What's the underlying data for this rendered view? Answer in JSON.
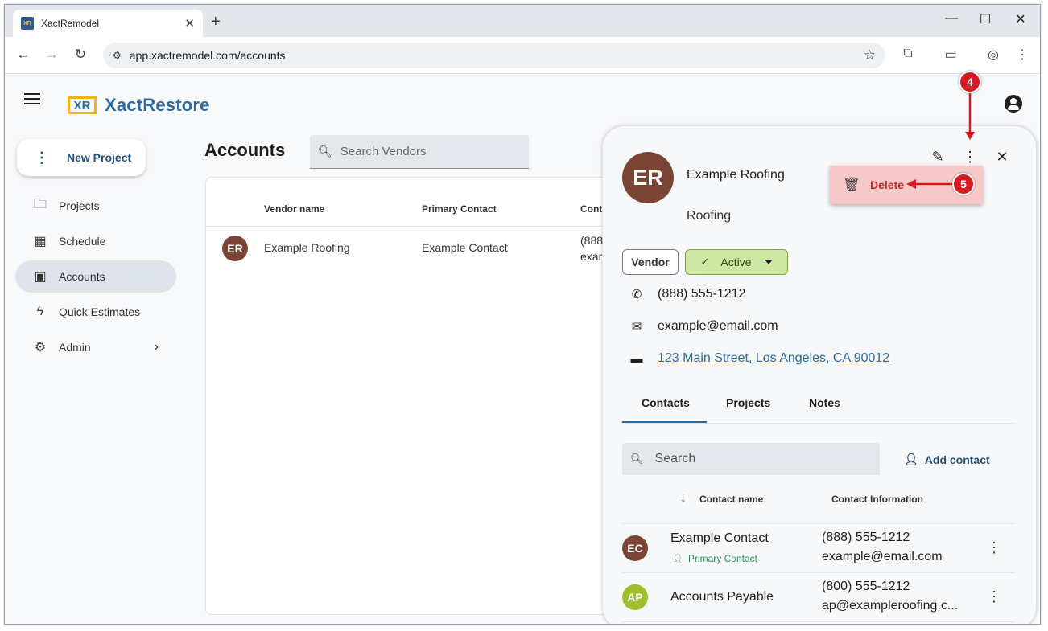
{
  "browser": {
    "tab_title": "XactRemodel",
    "favicon_text": "XR",
    "url": "app.xactremodel.com/accounts",
    "icons": [
      "back-icon",
      "forward-icon",
      "reload-icon",
      "tune-icon",
      "star-icon",
      "extensions-icon",
      "cast-icon",
      "profile-icon",
      "menu-icon"
    ]
  },
  "app": {
    "logo_text": "XR",
    "brand": "XactRestore",
    "accent": "#2d6aa0",
    "logo_color": "#f2b515"
  },
  "sidebar": {
    "new_project": "New Project",
    "items": [
      {
        "label": "Projects",
        "icon": "folder-icon"
      },
      {
        "label": "Schedule",
        "icon": "calendar-icon"
      },
      {
        "label": "Accounts",
        "icon": "contact-card-icon",
        "active": true
      },
      {
        "label": "Quick Estimates",
        "icon": "bolt-icon"
      },
      {
        "label": "Admin",
        "icon": "gear-icon"
      }
    ]
  },
  "main": {
    "title": "Accounts",
    "search_placeholder": "Search Vendors",
    "columns": [
      "Vendor name",
      "Primary Contact",
      "Cont"
    ],
    "rows": [
      {
        "avatar": "ER",
        "vendor": "Example Roofing",
        "contact": "Example Contact",
        "info_line1": "(888",
        "info_line2": "exar"
      }
    ]
  },
  "panel": {
    "avatar": "ER",
    "avatar_color": "#7b4535",
    "name": "Example Roofing",
    "type": "Roofing",
    "chip_vendor": "Vendor",
    "chip_status": "Active",
    "status_color": "#cfe7a4",
    "phone": "(888) 555-1212",
    "email": "example@email.com",
    "address": "123 Main Street, Los Angeles, CA 90012",
    "tabs": [
      "Contacts",
      "Projects",
      "Notes"
    ],
    "contact_search_placeholder": "Search",
    "add_contact": "Add contact",
    "contact_columns": [
      "Contact name",
      "Contact Information"
    ],
    "contacts": [
      {
        "avatar": "EC",
        "color": "#7b4535",
        "name": "Example Contact",
        "badge": "Primary Contact",
        "phone": "(888) 555-1212",
        "email": "example@email.com"
      },
      {
        "avatar": "AP",
        "color": "#9cbf2b",
        "name": "Accounts Payable",
        "phone": "(800) 555-1212",
        "email": "ap@exampleroofing.c..."
      }
    ]
  },
  "menu": {
    "delete_label": "Delete",
    "highlight_color": "#f7c9c9"
  },
  "annotations": {
    "step_4": "4",
    "step_5": "5",
    "color": "#d71921"
  }
}
